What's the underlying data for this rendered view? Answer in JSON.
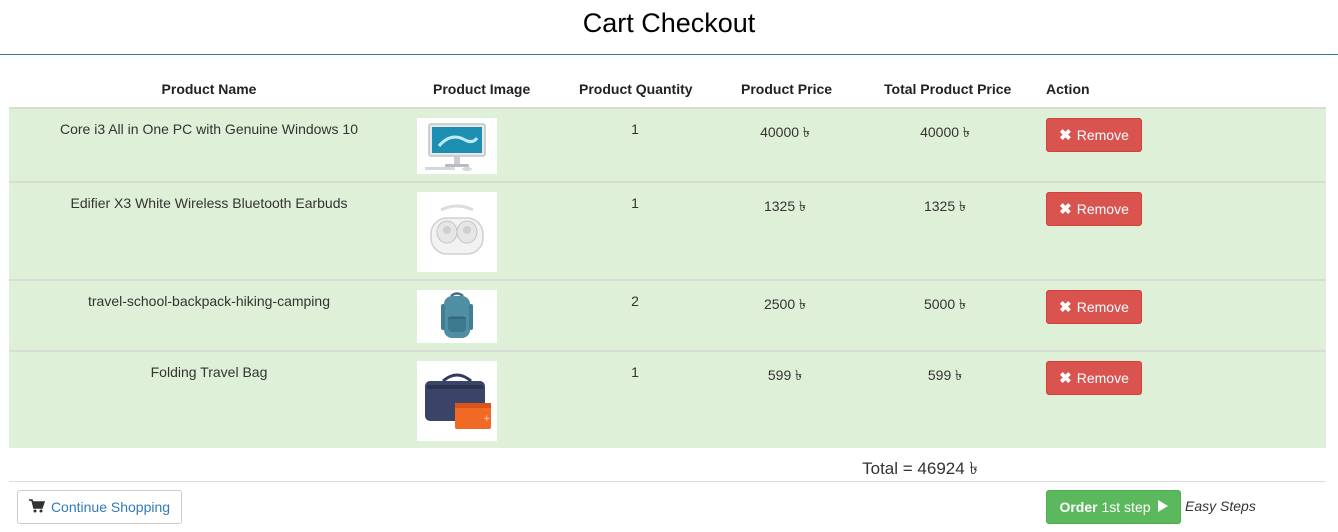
{
  "page": {
    "title": "Cart Checkout"
  },
  "table": {
    "headers": {
      "name": "Product Name",
      "image": "Product Image",
      "quantity": "Product Quantity",
      "price": "Product Price",
      "total": "Total Product Price",
      "action": "Action"
    },
    "rows": [
      {
        "name": "Core i3 All in One PC with Genuine Windows 10",
        "image_icon": "all-in-one-pc-image",
        "quantity": "1",
        "price": "40000 ৳",
        "total": "40000 ৳",
        "action": "Remove"
      },
      {
        "name": "Edifier X3 White Wireless Bluetooth Earbuds",
        "image_icon": "earbuds-image",
        "quantity": "1",
        "price": "1325 ৳",
        "total": "1325 ৳",
        "action": "Remove"
      },
      {
        "name": "travel-school-backpack-hiking-camping",
        "image_icon": "backpack-image",
        "quantity": "2",
        "price": "2500 ৳",
        "total": "5000 ৳",
        "action": "Remove"
      },
      {
        "name": "Folding Travel Bag",
        "image_icon": "travel-bag-image",
        "quantity": "1",
        "price": "599 ৳",
        "total": "599 ৳",
        "action": "Remove"
      }
    ]
  },
  "summary": {
    "total": "Total = 46924 ৳"
  },
  "footer": {
    "continue_label": "Continue Shopping",
    "order_bold": "Order",
    "order_rest": "1st step",
    "easy_steps": "Easy Steps"
  },
  "colors": {
    "row_bg": "#dff0d8",
    "remove": "#d9534f",
    "order": "#5cb85c",
    "link": "#337ab7"
  }
}
